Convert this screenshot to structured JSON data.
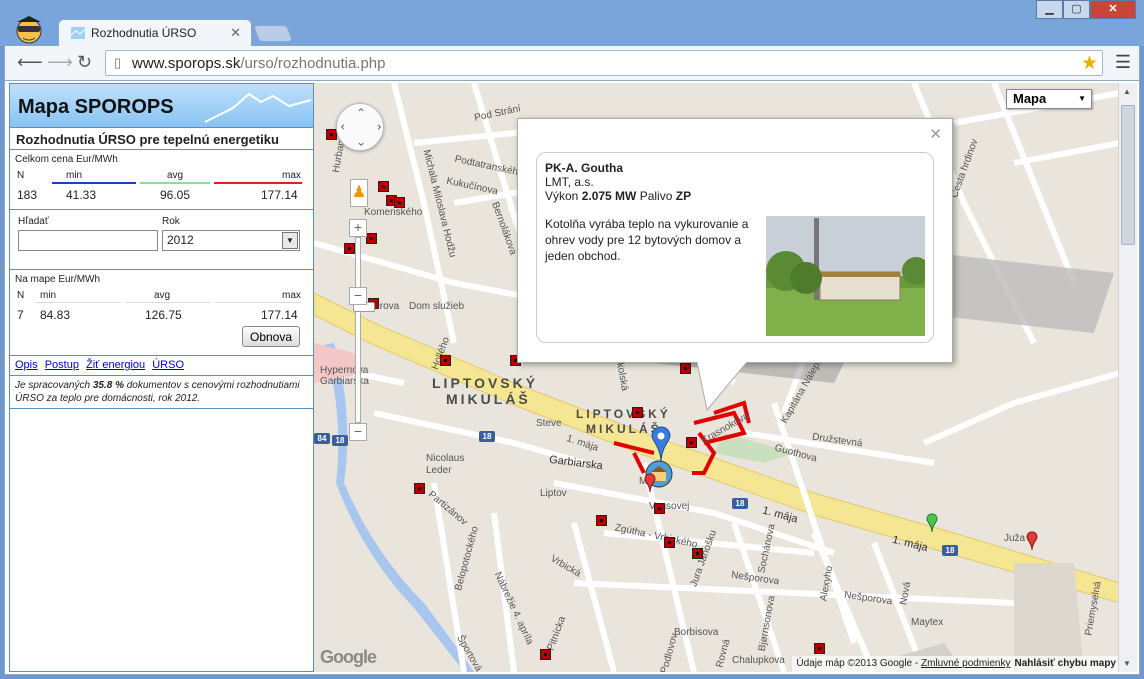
{
  "browser": {
    "tab_title": "Rozhodnutia ÚRSO",
    "url_host": "www.sporops.sk",
    "url_path": "/urso/rozhodnutia.php",
    "close_label": "✕"
  },
  "sidebar": {
    "title": "Mapa SPOROPS",
    "subtitle": "Rozhodnutia ÚRSO pre tepelnú energetiku",
    "total": {
      "label": "Celkom cena Eur/MWh",
      "headers": [
        "N",
        "min",
        "avg",
        "max"
      ],
      "values": [
        "183",
        "41.33",
        "96.05",
        "177.14"
      ]
    },
    "filters": {
      "search_label": "Hľadať",
      "search_value": "",
      "year_label": "Rok",
      "year_value": "2012"
    },
    "on_map": {
      "label": "Na mape Eur/MWh",
      "headers": [
        "N",
        "min",
        "avg",
        "max"
      ],
      "values": [
        "7",
        "84.83",
        "126.75",
        "177.14"
      ],
      "refresh_label": "Obnova"
    },
    "links": [
      "Opis",
      "Postup",
      "Žiť energiou",
      "ÚRSO"
    ],
    "note_pre": "Je spracovaných ",
    "note_bold": "35.8 %",
    "note_post": " dokumentov s cenovými rozhodnutiami ÚRSO za teplo pre domácnosti, rok 2012."
  },
  "map": {
    "type_label": "Mapa",
    "labels": {
      "city1": "LIPTOVSKÝ",
      "city2": "MIKULÁŠ",
      "city3": "LIPTOVSKÝ",
      "city4": "MIKULÁŠ",
      "garbiarska": "Garbiarska",
      "maja1": "1. mája",
      "maja2": "1. mája",
      "maja3": "1. mája",
      "nesporova1": "Nešporova",
      "nesporova2": "Nešporova",
      "vansovej": "Vansovej",
      "guothova": "Guothova",
      "druzstevna": "Družstevná",
      "kaptana": "Kapitána Nálepku",
      "skolska": "Školská",
      "zgutha": "Zgútha - Vrbického",
      "vrbicka": "Vrbická",
      "borbisova": "Borbisova",
      "maytex": "Maytex",
      "dom": "Dom služieb",
      "hypernova": "Hypernova Garbiarska",
      "steve": "Steve",
      "nicolaus": "Nicolaus Leder",
      "liptov": "Liptov",
      "podstrani": "Pod Strání",
      "podtatranskeho": "Podtatranského",
      "kukucinova": "Kukučínova",
      "bernolakova": "Bernolákova",
      "komenskeho": "Komenského",
      "hurbanova": "Hurbanova",
      "mmh": "Michala Miloslava Hodžu",
      "partizanov": "Partizánov",
      "belopotockeho": "Belopotockého",
      "nabrezie": "Nábrežie 4. apríla",
      "pribinova": "Priemyselná",
      "alexyho": "Alexyho",
      "bjornsonova": "Bjørnsonova",
      "sochanova": "Sochánova",
      "jura": "Jura Janošku",
      "nova": "Nová",
      "cesta": "Cesta hrdinov",
      "juza": "Juža",
      "metro": "Metro",
      "pitnicka": "Pitnícka",
      "sportova": "Športová",
      "chalupkova": "Chalupkova",
      "podlovova": "Podlovov",
      "ruzova": "Rovná",
      "oslo": "Orova",
      "holeho": "Hollého",
      "krasnokova": "Krasnokova"
    },
    "shields": [
      "18",
      "18",
      "18",
      "18",
      "84"
    ],
    "copyright": "Údaje máp ©2013 Google - ",
    "terms": "Zmluvné podmienky",
    "report": "Nahlásiť chybu mapy",
    "google": "Google"
  },
  "infowindow": {
    "name": "PK-A. Goutha",
    "company": "LMT, a.s.",
    "power_label": "Výkon ",
    "power_value": "2.075 MW",
    "fuel_label": " Palivo ",
    "fuel_value": "ZP",
    "description": "Kotolňa vyrába teplo na vykurovanie a ohrev vody pre 12 bytových domov a jeden obchod."
  }
}
